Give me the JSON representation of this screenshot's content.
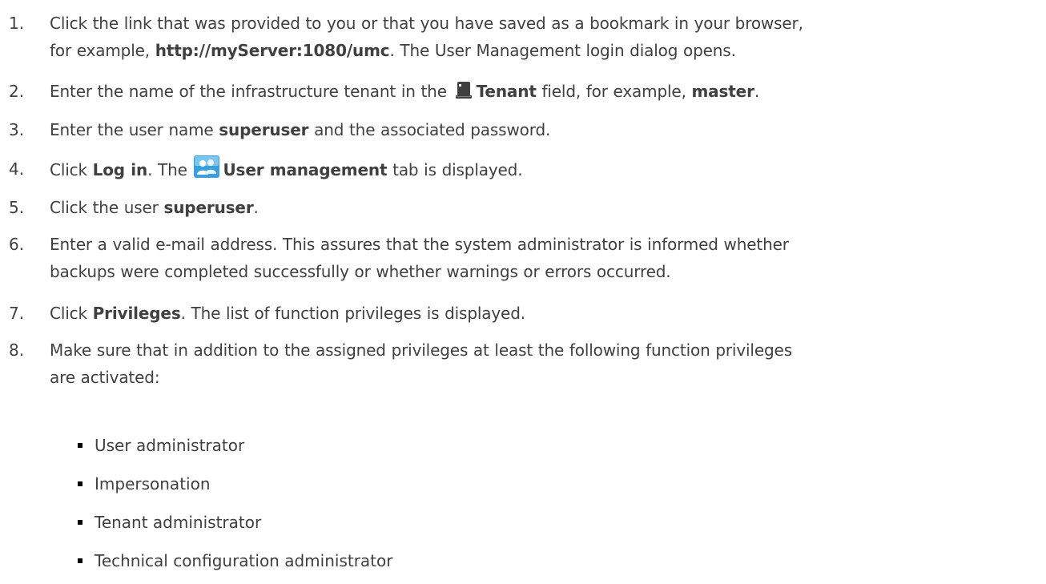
{
  "steps": [
    {
      "number": "1.",
      "line1": {
        "a": "Click the link that was provided to you or that you have saved as a bookmark in your browser,"
      },
      "line2": {
        "a": "for example, ",
        "b": "http://myServer:1080/umc",
        "c": ". The User Management login dialog opens."
      }
    },
    {
      "number": "2.",
      "a": "Enter the name of the infrastructure tenant in the ",
      "icon": "tenant-server-icon",
      "b": "Tenant",
      "c": " field, for example, ",
      "d": "master",
      "e": "."
    },
    {
      "number": "3.",
      "a": "Enter the user name ",
      "b": "superuser",
      "c": " and the associated password."
    },
    {
      "number": "4.",
      "a": "Click ",
      "b": "Log in",
      "c": ". The ",
      "icon": "user-management-icon",
      "d": "User management",
      "e": " tab is displayed."
    },
    {
      "number": "5.",
      "a": "Click the user ",
      "b": "superuser",
      "c": "."
    },
    {
      "number": "6.",
      "line1": "Enter a valid e-mail address. This assures that the system administrator is informed whether",
      "line2": "backups were completed successfully or whether warnings or errors occurred."
    },
    {
      "number": "7.",
      "a": "Click ",
      "b": "Privileges",
      "c": ". The list of function privileges is displayed."
    },
    {
      "number": "8.",
      "line1": "Make sure that in addition to the assigned privileges at least the following function privileges",
      "line2": "are activated:"
    }
  ],
  "bullets": [
    "User administrator",
    "Impersonation",
    "Tenant administrator",
    "Technical configuration administrator"
  ],
  "colors": {
    "text": "#404040",
    "tenant_icon": "#404040",
    "user_mgmt_icon": "#3aa0dc"
  }
}
